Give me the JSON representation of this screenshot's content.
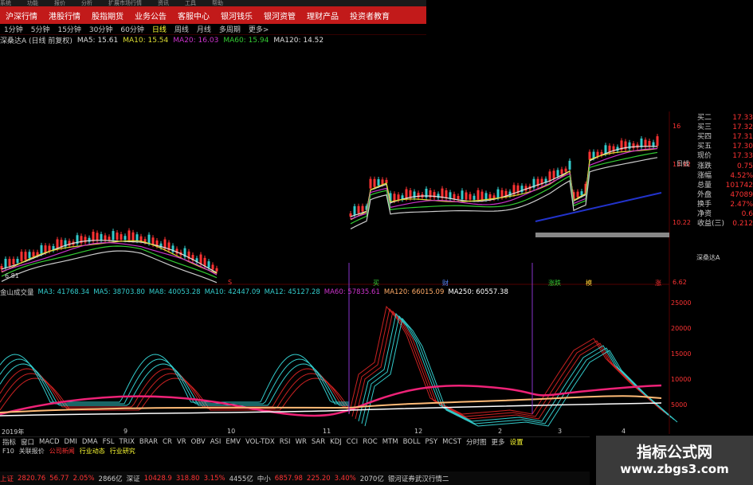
{
  "topbar": {
    "items": [
      "系统",
      "功能",
      "报价",
      "分析",
      "扩展市场行情",
      "资讯",
      "工具",
      "帮助"
    ]
  },
  "nav": {
    "items": [
      "沪深行情",
      "港股行情",
      "股指期货",
      "业务公告",
      "客服中心",
      "银河钱乐",
      "银河资管",
      "理财产品",
      "投资者教育"
    ]
  },
  "periods": {
    "items": [
      "1分钟",
      "5分钟",
      "15分钟",
      "30分钟",
      "60分钟",
      "日线",
      "周线",
      "月线",
      "多周期",
      "更多>"
    ],
    "selected": 5
  },
  "ma_line": {
    "title": "深桑达A (日线 前复权)",
    "items": [
      {
        "text": "MA5: 15.61",
        "color": "#dddddd"
      },
      {
        "text": "MA10: 15.54",
        "color": "#dddd33"
      },
      {
        "text": "MA20: 16.03",
        "color": "#cc33cc"
      },
      {
        "text": "MA60: 15.94",
        "color": "#33cc33"
      },
      {
        "text": "MA120: 14.52",
        "color": "#dddddd"
      }
    ]
  },
  "price_scale": {
    "labels": [
      "16",
      "13.92",
      "10.22",
      "6.62",
      "6.81"
    ]
  },
  "quote_panel": {
    "rows": [
      {
        "label": "买二",
        "value": "17.33"
      },
      {
        "label": "买三",
        "value": "17.32"
      },
      {
        "label": "买四",
        "value": "17.31"
      },
      {
        "label": "买五",
        "value": "17.30"
      },
      {
        "label": "现价",
        "value": "17.33"
      },
      {
        "label": "涨跌",
        "value": "0.75"
      },
      {
        "label": "涨幅",
        "value": "4.52%"
      },
      {
        "label": "总量",
        "value": "101742"
      },
      {
        "label": "外盘",
        "value": "47089"
      },
      {
        "label": "换手",
        "value": "2.47%"
      },
      {
        "label": "净资",
        "value": "0.6"
      },
      {
        "label": "收益(三)",
        "value": "0.212"
      }
    ],
    "side_label": "日线",
    "mini_title": "深桑达A"
  },
  "markers": {
    "items": [
      "S",
      "买",
      "财",
      "涨跌",
      "模",
      "涨"
    ]
  },
  "indicator": {
    "name": "金山成交量",
    "items": [
      {
        "text": "MA3: 41768.34",
        "color": "#33cccc"
      },
      {
        "text": "MA5: 38703.80",
        "color": "#33cccc"
      },
      {
        "text": "MA8: 40053.28",
        "color": "#33cccc"
      },
      {
        "text": "MA10: 42447.09",
        "color": "#33cccc"
      },
      {
        "text": "MA12: 45127.28",
        "color": "#33cccc"
      },
      {
        "text": "MA60: 57835.61",
        "color": "#cc33cc"
      },
      {
        "text": "MA120: 66015.09",
        "color": "#ffaa66"
      },
      {
        "text": "MA250: 60557.38",
        "color": "#ffffff"
      }
    ],
    "scale": [
      "25000",
      "20000",
      "15000",
      "10000",
      "5000"
    ]
  },
  "date_axis": {
    "labels": [
      "2019年",
      "9",
      "10",
      "11",
      "12",
      "2",
      "3",
      "4"
    ]
  },
  "tabs": {
    "items": [
      "指标",
      "窗口",
      "MACD",
      "DMI",
      "DMA",
      "FSL",
      "TRIX",
      "BRAR",
      "CR",
      "VR",
      "OBV",
      "ASI",
      "EMV",
      "VOL-TDX",
      "RSI",
      "WR",
      "SAR",
      "KDJ",
      "CCI",
      "ROC",
      "MTM",
      "BOLL",
      "PSY",
      "MCST",
      "分时图",
      "更多",
      "设置"
    ],
    "active": 26
  },
  "subtabs": {
    "items": [
      {
        "text": "F10",
        "color": "#cccccc"
      },
      {
        "text": "关联报价",
        "color": "#cccccc"
      },
      {
        "text": "公司新闻",
        "color": "#ff3333"
      },
      {
        "text": "行业动态",
        "color": "#ffff33"
      },
      {
        "text": "行业研究",
        "color": "#ffff33"
      }
    ]
  },
  "status": {
    "items": [
      {
        "text": "上证",
        "color": "#ff3333"
      },
      {
        "text": "2820.76",
        "color": "#ff3333"
      },
      {
        "text": "56.77",
        "color": "#ff3333"
      },
      {
        "text": "2.05%",
        "color": "#ff3333"
      },
      {
        "text": "2866亿",
        "color": "#cccccc"
      },
      {
        "text": "深证",
        "color": "#cccccc"
      },
      {
        "text": "10428.9",
        "color": "#ff3333"
      },
      {
        "text": "318.80",
        "color": "#ff3333"
      },
      {
        "text": "3.15%",
        "color": "#ff3333"
      },
      {
        "text": "4455亿",
        "color": "#cccccc"
      },
      {
        "text": "中小",
        "color": "#cccccc"
      },
      {
        "text": "6857.98",
        "color": "#ff3333"
      },
      {
        "text": "225.20",
        "color": "#ff3333"
      },
      {
        "text": "3.40%",
        "color": "#ff3333"
      },
      {
        "text": "2070亿",
        "color": "#cccccc"
      },
      {
        "text": "银河证券武汉行情二",
        "color": "#cccccc"
      }
    ]
  },
  "watermark": {
    "line1": "指标公式网",
    "line2": "www.zbgs3.com"
  },
  "colors": {
    "up": "#ff3333",
    "down": "#33cccc",
    "ma5": "#dddddd",
    "ma10": "#dddd33",
    "ma20": "#cc33cc",
    "ma60": "#33cc33",
    "vol_pink": "#ee2277",
    "vol_orange": "#ffbb77"
  }
}
